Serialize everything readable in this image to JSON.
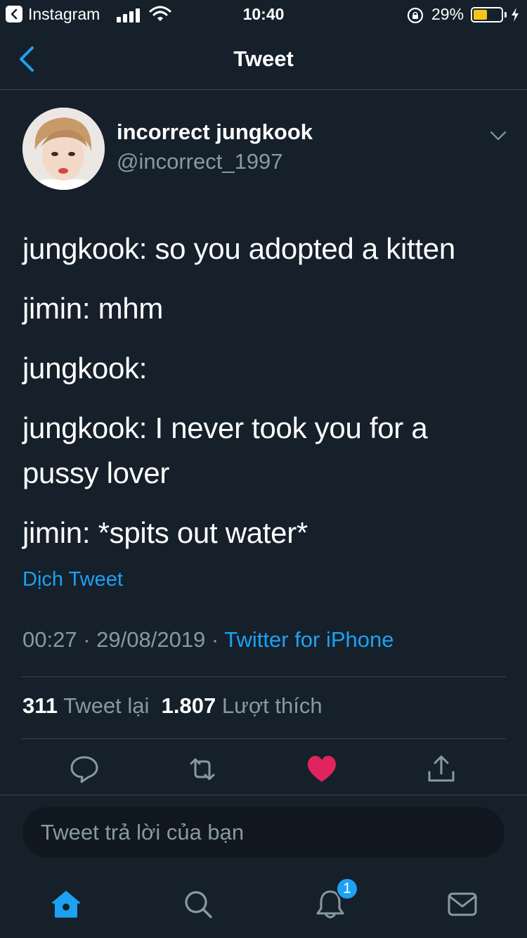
{
  "status_bar": {
    "back_app": "Instagram",
    "time": "10:40",
    "battery_percent": "29%",
    "battery_level": 0.29,
    "icons": [
      "signal-icon",
      "wifi-icon",
      "orientation-lock-icon",
      "battery-icon",
      "charging-bolt-icon"
    ]
  },
  "nav": {
    "title": "Tweet",
    "back_icon": "chevron-left-icon"
  },
  "author": {
    "name": "incorrect jungkook",
    "handle": "@incorrect_1997",
    "menu_icon": "chevron-down-icon"
  },
  "tweet": {
    "lines": [
      "jungkook: so you adopted a kitten",
      "jimin: mhm",
      "jungkook:",
      "jungkook: I never took you for a pussy lover",
      "jimin: *spits out water*"
    ],
    "translate_label": "Dịch Tweet",
    "time": "00:27",
    "date": "29/08/2019",
    "separator": " · ",
    "source": "Twitter for iPhone"
  },
  "stats": {
    "retweets_count": "311",
    "retweets_label": "Tweet lại",
    "likes_count": "1.807",
    "likes_label": "Lượt thích"
  },
  "actions": {
    "icons": [
      "reply-icon",
      "retweet-icon",
      "like-icon",
      "share-icon"
    ],
    "liked": true,
    "like_color": "#e0245e"
  },
  "reply": {
    "placeholder": "Tweet trả lời của bạn"
  },
  "tabbar": {
    "icons": [
      "home-icon",
      "search-icon",
      "notifications-icon",
      "messages-icon"
    ],
    "active": "home-icon",
    "notification_badge": "1"
  },
  "colors": {
    "background": "#15202b",
    "accent": "#1da1f2",
    "muted": "#8899a6",
    "divider": "#38444d"
  }
}
